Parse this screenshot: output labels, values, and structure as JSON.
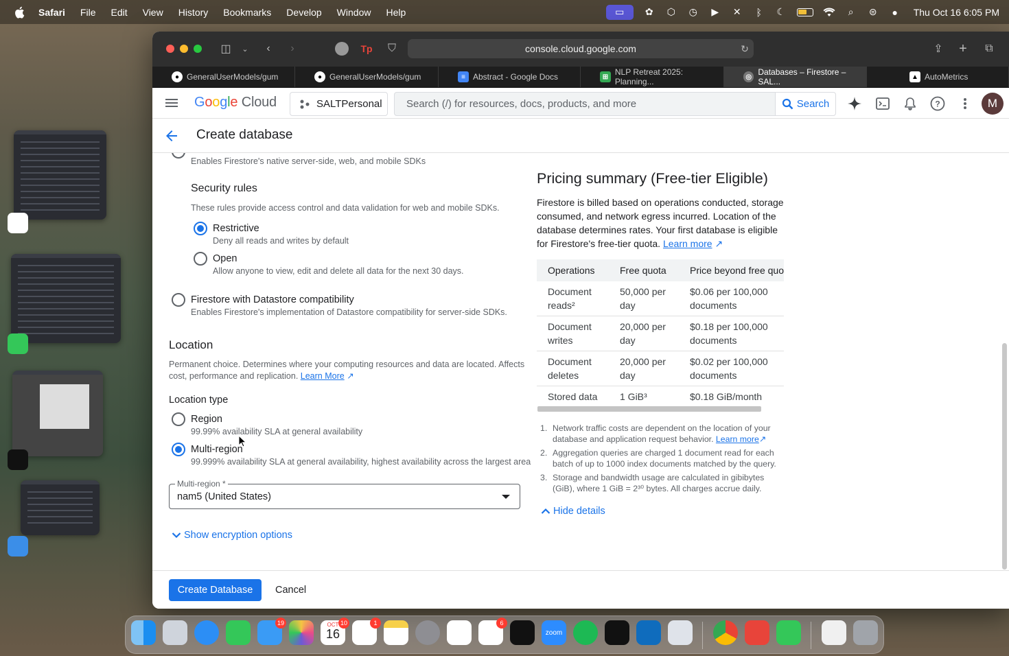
{
  "menubar": {
    "app": "Safari",
    "items": [
      "File",
      "Edit",
      "View",
      "History",
      "Bookmarks",
      "Develop",
      "Window",
      "Help"
    ],
    "clock": "Thu Oct 16  6:05 PM"
  },
  "browser": {
    "address": "console.cloud.google.com",
    "tabs": [
      {
        "label": "GeneralUserModels/gum",
        "icon": "github-icon"
      },
      {
        "label": "GeneralUserModels/gum",
        "icon": "github-icon"
      },
      {
        "label": "Abstract - Google Docs",
        "icon": "docs-icon"
      },
      {
        "label": "NLP Retreat 2025: Planning...",
        "icon": "sheets-icon"
      },
      {
        "label": "Databases – Firestore – SAL...",
        "icon": "gcp-icon",
        "active": true
      },
      {
        "label": "AutoMetrics",
        "icon": "autometrics-icon"
      }
    ]
  },
  "gcp": {
    "logo_google": "Google",
    "logo_cloud": "Cloud",
    "project": "SALTPersonal",
    "search_placeholder": "Search (/) for resources, docs, products, and more",
    "search_button": "Search",
    "avatar": "M"
  },
  "page": {
    "title": "Create database",
    "native_sdk_desc": "Enables Firestore's native server-side, web, and mobile SDKs",
    "security_rules": {
      "heading": "Security rules",
      "desc": "These rules provide access control and data validation for web and mobile SDKs.",
      "options": [
        {
          "label": "Restrictive",
          "desc": "Deny all reads and writes by default",
          "selected": true
        },
        {
          "label": "Open",
          "desc": "Allow anyone to view, edit and delete all data for the next 30 days.",
          "selected": false
        }
      ]
    },
    "datastore": {
      "label": "Firestore with Datastore compatibility",
      "desc": "Enables Firestore's implementation of Datastore compatibility for server-side SDKs."
    },
    "location": {
      "heading": "Location",
      "desc_line1": "Permanent choice. Determines where your computing resources and data are located. Affects",
      "desc_line2": "cost, performance and replication.",
      "learn_more": "Learn More",
      "type_heading": "Location type",
      "options": [
        {
          "label": "Region",
          "desc": "99.99% availability SLA at general availability",
          "selected": false
        },
        {
          "label": "Multi-region",
          "desc": "99.999% availability SLA at general availability, highest availability across the largest area",
          "selected": true
        }
      ],
      "select_label": "Multi-region *",
      "select_value": "nam5 (United States)"
    },
    "encryption_toggle": "Show encryption options",
    "create_button": "Create Database",
    "cancel_button": "Cancel"
  },
  "pricing": {
    "heading": "Pricing summary (Free-tier Eligible)",
    "desc_lines": [
      "Firestore is billed based on operations conducted, storage",
      "consumed, and network egress incurred. Location of the",
      "database determines rates. Your first database is eligible",
      "for Firestore's free-tier quota."
    ],
    "learn_more": "Learn more",
    "columns": [
      "Operations",
      "Free quota",
      "Price beyond free quota"
    ],
    "rows": [
      [
        "Document reads²",
        "50,000 per day",
        "$0.06 per 100,000 documents"
      ],
      [
        "Document writes",
        "20,000 per day",
        "$0.18 per 100,000 documents"
      ],
      [
        "Document deletes",
        "20,000 per day",
        "$0.02 per 100,000 documents"
      ],
      [
        "Stored data",
        "1 GiB³",
        "$0.18 GiB/month"
      ]
    ],
    "notes": [
      {
        "num": "1.",
        "text": "Network traffic costs are dependent on the location of your database and application request behavior.",
        "link": "Learn more"
      },
      {
        "num": "2.",
        "text": "Aggregation queries are charged 1 document read for each batch of up to 1000 index documents matched by the query."
      },
      {
        "num": "3.",
        "text": "Storage and bandwidth usage are calculated in gibibytes (GiB), where 1 GiB = 2³⁰ bytes. All charges accrue daily."
      }
    ],
    "hide_details": "Hide details"
  },
  "dock": {
    "badges": {
      "mail": "19",
      "calendar_month": "OCT",
      "calendar_day": "16",
      "calendar_badge": "10",
      "reminders": "1",
      "slack": "6"
    },
    "zoom_label": "zoom"
  },
  "colors": {
    "accent": "#1a73e8",
    "primary_text": "#202124",
    "secondary_text": "#5f6368"
  }
}
